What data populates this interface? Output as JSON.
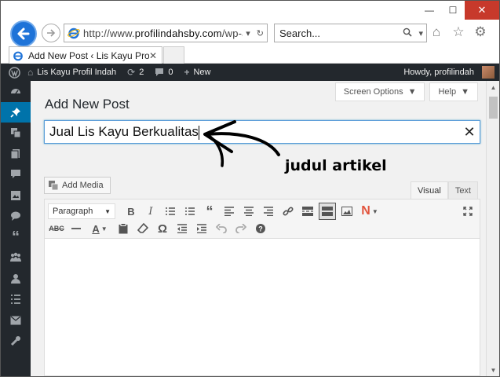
{
  "browser": {
    "window_controls": {
      "minimize": "—",
      "maximize": "☐",
      "close": "✕"
    },
    "address": {
      "scheme": "http://www.",
      "host": "profilindahsby.com",
      "path": "/wp-a"
    },
    "search": {
      "placeholder": "Search..."
    },
    "tab": {
      "label": "Add New Post ‹ Lis Kayu Profil Pr...",
      "close": "✕"
    }
  },
  "adminbar": {
    "site": "Lis Kayu Profil Indah",
    "updates_count": "2",
    "comments_count": "0",
    "new_label": "New",
    "howdy": "Howdy, profilindah"
  },
  "screen": {
    "screen_options": "Screen Options",
    "help": "Help",
    "page_title": "Add New Post",
    "post_title_value": "Jual Lis Kayu Berkualitas",
    "annotation": "judul artikel",
    "add_media": "Add Media",
    "visual_tab": "Visual",
    "text_tab": "Text",
    "format_select": "Paragraph"
  },
  "colors": {
    "admin_bar": "#23282d",
    "active_menu": "#0073aa",
    "ie_back": "#1e73d8",
    "close": "#c7392b"
  }
}
